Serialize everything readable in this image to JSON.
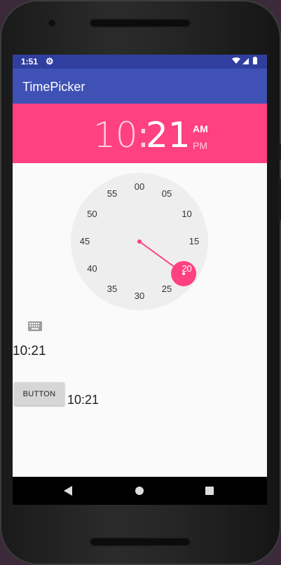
{
  "status_bar": {
    "time": "1:51",
    "settings_icon": "gear-icon",
    "indicators": "wifi-icon signal-icon battery-icon"
  },
  "app_bar": {
    "title": "TimePicker"
  },
  "time_picker": {
    "hour": "10",
    "colon": ":",
    "minute": "21",
    "am": "AM",
    "pm": "PM",
    "selected_period": "AM",
    "minute_labels": [
      "00",
      "05",
      "10",
      "15",
      "20",
      "25",
      "30",
      "35",
      "40",
      "45",
      "50",
      "55"
    ],
    "selected_minute": 21,
    "accent_color": "#ff4081",
    "face_color": "#eeeeee"
  },
  "content": {
    "keyboard_icon": "keyboard-icon",
    "time_text_1": "10:21",
    "button_label": "BUTTON",
    "time_text_2": "10:21"
  },
  "nav_bar": {
    "back_icon": "back-triangle-icon",
    "home_icon": "home-circle-icon",
    "recents_icon": "recents-square-icon"
  },
  "colors": {
    "status_bar": "#303f9f",
    "app_bar": "#3f51b5",
    "header": "#ff4081"
  }
}
